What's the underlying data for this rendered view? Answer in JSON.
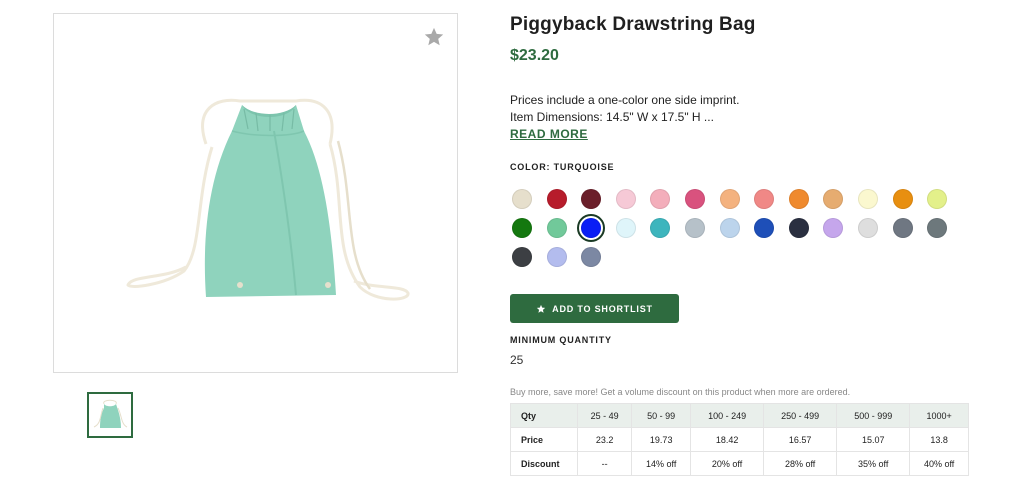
{
  "product": {
    "title": "Piggyback Drawstring Bag",
    "price": "$23.20",
    "description_lines": [
      "Prices include a one-color one side imprint.",
      "Item Dimensions: 14.5\" W x 17.5\" H ..."
    ],
    "read_more_label": "READ MORE",
    "image_icon": "drawstring-bag-image",
    "favorite_icon": "star-icon"
  },
  "color": {
    "label": "COLOR: TURQUOISE",
    "selected_index": 15,
    "swatches": [
      "#e6dfcc",
      "#b71c2b",
      "#6b1f2a",
      "#f6c9d6",
      "#f3aebb",
      "#d9527e",
      "#f4b27f",
      "#f08886",
      "#ef8a2e",
      "#e6ac70",
      "#fbf8cf",
      "#e88f10",
      "#e3f08a",
      "#14780f",
      "#71c99a",
      "#0a1ef5",
      "#dff5fa",
      "#3db5bd",
      "#b6c1c9",
      "#bcd4ec",
      "#1e4fb8",
      "#2a2f40",
      "#c5a6ec",
      "#dedede",
      "#6f7782",
      "#6d787c",
      "#3c3f43",
      "#b3bcee",
      "#7c88a3"
    ]
  },
  "shortlist": {
    "label": "ADD TO SHORTLIST",
    "icon": "star-icon"
  },
  "min_quantity": {
    "label": "MINIMUM QUANTITY",
    "value": "25"
  },
  "volume_note": "Buy more, save more! Get a volume discount on this product when more are ordered.",
  "pricing_table": {
    "headers": [
      "Qty",
      "25 - 49",
      "50 - 99",
      "100 - 249",
      "250 - 499",
      "500 - 999",
      "1000+"
    ],
    "rows": [
      [
        "Price",
        "23.2",
        "19.73",
        "18.42",
        "16.57",
        "15.07",
        "13.8"
      ],
      [
        "Discount",
        "--",
        "14% off",
        "20% off",
        "28% off",
        "35% off",
        "40% off"
      ]
    ]
  },
  "colors": {
    "brand_green": "#2e6b3f",
    "bag_turquoise": "#8fd3bd"
  }
}
